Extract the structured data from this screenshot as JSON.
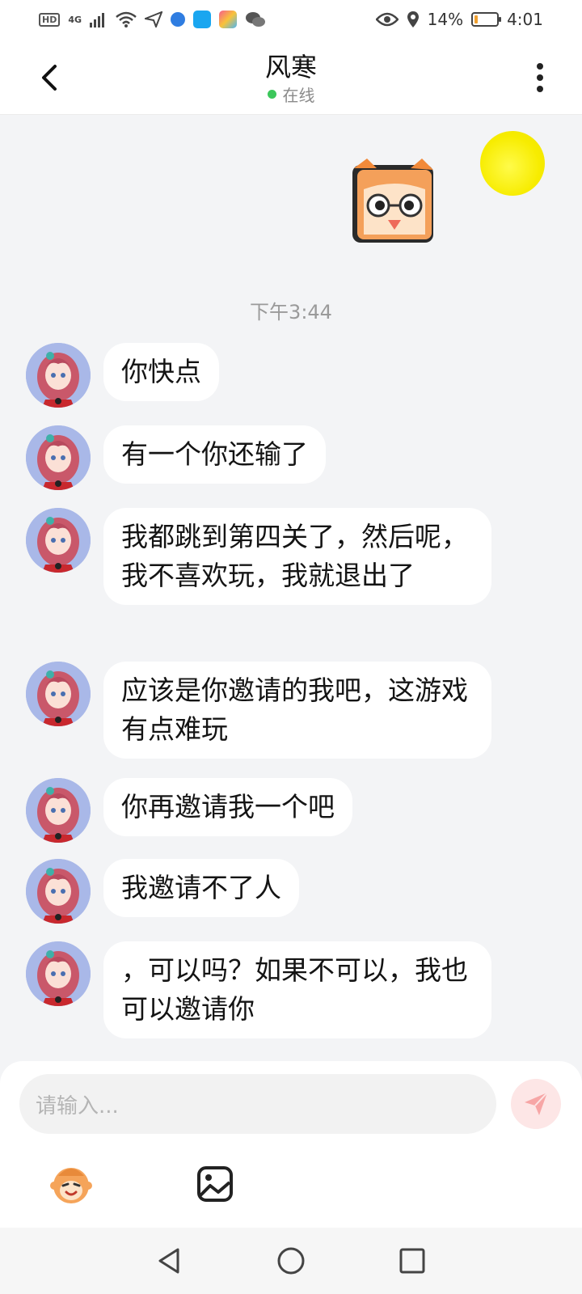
{
  "status_bar": {
    "hd": "HD",
    "signal": "4G",
    "battery_percent": "14%",
    "battery_level": 0.14,
    "time": "4:01"
  },
  "header": {
    "contact_name": "风寒",
    "online_status": "在线"
  },
  "chat": {
    "timestamp": "下午3:44",
    "messages": [
      {
        "text": "你快点"
      },
      {
        "text": "有一个你还输了"
      },
      {
        "text": "我都跳到第四关了，然后呢，我不喜欢玩，我就退出了"
      },
      {
        "text": "应该是你邀请的我吧，这游戏有点难玩"
      },
      {
        "text": "你再邀请我一个吧"
      },
      {
        "text": "我邀请不了人"
      },
      {
        "text": "，可以吗？如果不可以，我也可以邀请你"
      }
    ]
  },
  "input": {
    "placeholder": "请输入..."
  },
  "colors": {
    "online": "#3cc75b",
    "send_button": "#fde6e6",
    "send_icon": "#f7a6a6",
    "background": "#f3f4f6"
  },
  "icons": [
    "back-icon",
    "more-icon",
    "emoji-icon",
    "image-icon",
    "send-icon",
    "nav-back-icon",
    "nav-home-icon",
    "nav-recents-icon"
  ]
}
